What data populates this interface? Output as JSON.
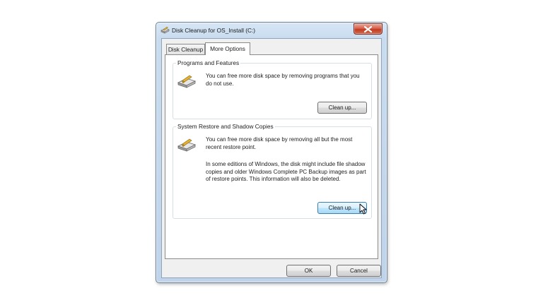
{
  "window": {
    "title": "Disk Cleanup for OS_Install (C:)",
    "icons": {
      "app": "disk-cleanup-icon",
      "close": "close-icon"
    }
  },
  "tabs": [
    {
      "label": "Disk Cleanup",
      "active": false
    },
    {
      "label": "More Options",
      "active": true
    }
  ],
  "groups": {
    "programs": {
      "title": "Programs and Features",
      "description": "You can free more disk space by removing programs that you do not use.",
      "button": "Clean up...",
      "icon": "programs-features-icon"
    },
    "restore": {
      "title": "System Restore and Shadow Copies",
      "description": "You can free more disk space by removing all but the most recent restore point.",
      "description2": "In some editions of Windows, the disk might include file shadow copies and older Windows Complete PC Backup images as part of restore points. This information will also be deleted.",
      "button": "Clean up...",
      "icon": "system-restore-icon"
    }
  },
  "footer": {
    "ok": "OK",
    "cancel": "Cancel"
  },
  "colors": {
    "title_bar": "#c9dcef",
    "close_button": "#c23a22",
    "hover_button": "#bee6fd"
  }
}
